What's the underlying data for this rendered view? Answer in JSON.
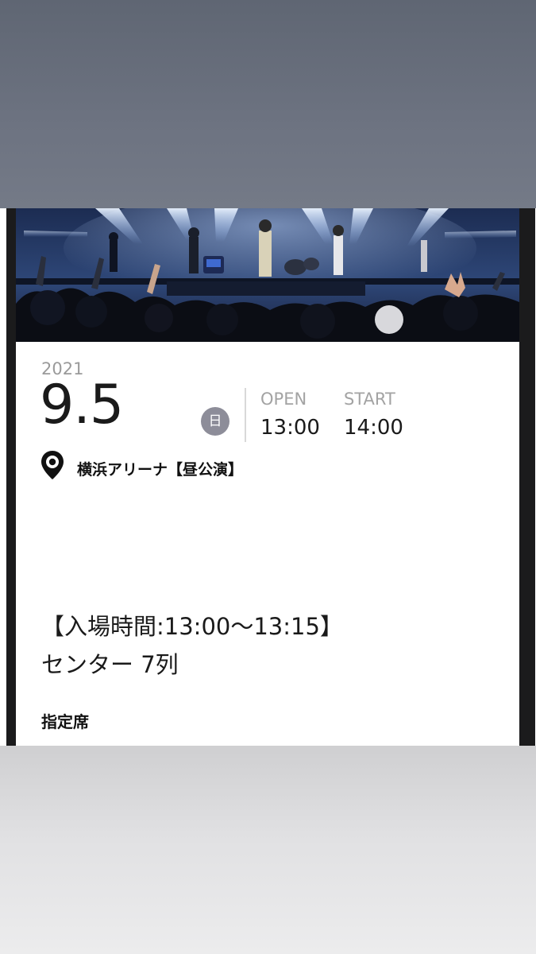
{
  "ticket": {
    "year": "2021",
    "date": "9.5",
    "weekday": "日",
    "open_label": "OPEN",
    "open_time": "13:00",
    "start_label": "START",
    "start_time": "14:00",
    "venue": "横浜アリーナ【昼公演】",
    "entry_time": "【入場時間:13:00〜13:15】",
    "seat": "センター 7列",
    "seat_type": "指定席"
  },
  "icons": {
    "location": "location-pin-icon"
  },
  "colors": {
    "top_band": "#6b7180",
    "frame": "#1b1b1c",
    "weekday_badge": "#8d8d99",
    "muted_text": "#a3a3a3"
  }
}
